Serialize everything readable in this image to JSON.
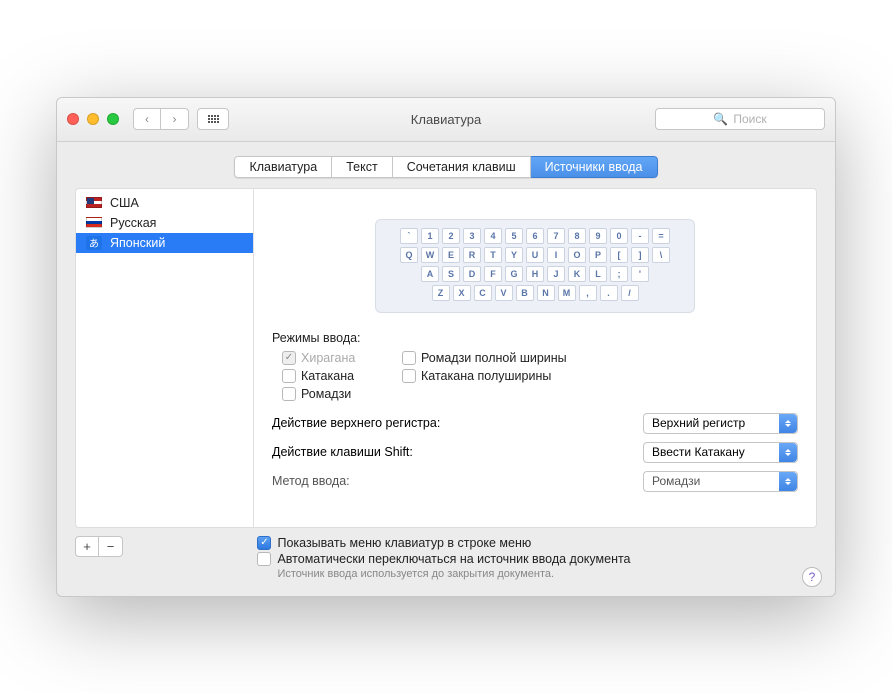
{
  "window": {
    "title": "Клавиатура"
  },
  "search": {
    "placeholder": "Поиск"
  },
  "tabs": [
    "Клавиатура",
    "Текст",
    "Сочетания клавиш",
    "Источники ввода"
  ],
  "active_tab_index": 3,
  "sources": [
    {
      "label": "США",
      "flag": "us"
    },
    {
      "label": "Русская",
      "flag": "ru"
    },
    {
      "label": "Японский",
      "flag": "jp"
    }
  ],
  "selected_source_index": 2,
  "keyboard_rows": [
    [
      "`",
      "1",
      "2",
      "3",
      "4",
      "5",
      "6",
      "7",
      "8",
      "9",
      "0",
      "-",
      "="
    ],
    [
      "Q",
      "W",
      "E",
      "R",
      "T",
      "Y",
      "U",
      "I",
      "O",
      "P",
      "[",
      "]",
      "\\"
    ],
    [
      "A",
      "S",
      "D",
      "F",
      "G",
      "H",
      "J",
      "K",
      "L",
      ";",
      "'"
    ],
    [
      "Z",
      "X",
      "C",
      "V",
      "B",
      "N",
      "M",
      ",",
      ".",
      "/"
    ]
  ],
  "modes": {
    "title": "Режимы ввода:",
    "items": [
      {
        "label": "Хирагана",
        "checked": true,
        "disabled": true
      },
      {
        "label": "Ромадзи полной ширины",
        "checked": false
      },
      {
        "label": "Катакана",
        "checked": false
      },
      {
        "label": "Катакана полуширины",
        "checked": false
      },
      {
        "label": "Ромадзи",
        "checked": false
      }
    ]
  },
  "actions": {
    "caps": {
      "label": "Действие верхнего регистра:",
      "value": "Верхний регистр"
    },
    "shift": {
      "label": "Действие клавиши Shift:",
      "value": "Ввести Катакану"
    },
    "method": {
      "label": "Метод ввода:",
      "value": "Ромадзи"
    }
  },
  "footer": {
    "show_menu": {
      "label": "Показывать меню клавиатур в строке меню",
      "checked": true
    },
    "auto_switch": {
      "label": "Автоматически переключаться на источник ввода документа",
      "checked": false
    },
    "hint": "Источник ввода используется до закрытия документа."
  },
  "jp_glyph": "あ"
}
